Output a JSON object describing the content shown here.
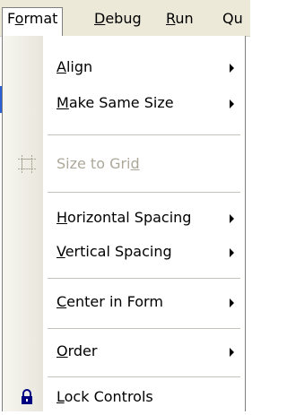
{
  "menubar": {
    "items": [
      {
        "pre": "F",
        "mnemonic": "o",
        "post": "rmat"
      },
      {
        "pre": "",
        "mnemonic": "D",
        "post": "ebug"
      },
      {
        "pre": "",
        "mnemonic": "R",
        "post": "un"
      },
      {
        "pre": "Qu",
        "mnemonic": "",
        "post": ""
      }
    ]
  },
  "menu": {
    "align": {
      "pre": "",
      "mnemonic": "A",
      "post": "lign"
    },
    "make_same_size": {
      "pre": "",
      "mnemonic": "M",
      "post": "ake Same Size"
    },
    "size_to_grid": {
      "pre": "Size to Gri",
      "mnemonic": "d",
      "post": ""
    },
    "horizontal_spacing": {
      "pre": "",
      "mnemonic": "H",
      "post": "orizontal Spacing"
    },
    "vertical_spacing": {
      "pre": "",
      "mnemonic": "V",
      "post": "ertical Spacing"
    },
    "center_in_form": {
      "pre": "",
      "mnemonic": "C",
      "post": "enter in Form"
    },
    "order": {
      "pre": "",
      "mnemonic": "O",
      "post": "rder"
    },
    "lock_controls": {
      "pre": "",
      "mnemonic": "L",
      "post": "ock Controls"
    }
  },
  "icons": {
    "size_to_grid": "grid-icon",
    "lock_controls": "lock-icon"
  }
}
